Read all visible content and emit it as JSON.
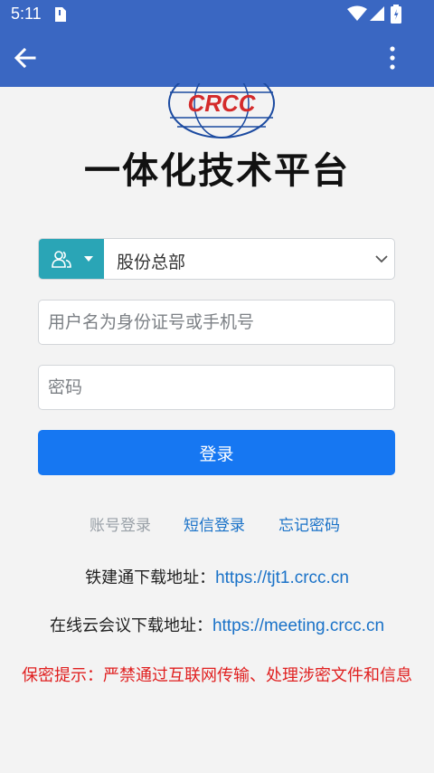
{
  "status_bar": {
    "time": "5:11",
    "icons": [
      "sim-icon",
      "wifi-icon",
      "signal-icon",
      "battery-icon"
    ]
  },
  "app_bar": {
    "back_icon": "arrow-left-icon",
    "menu_icon": "more-vertical-icon",
    "color": "#3a67c2"
  },
  "logo": {
    "text": "CRCC",
    "color": "#d42a2a"
  },
  "title": "一体化技术平台",
  "org_select": {
    "icon": "users-icon",
    "value": "股份总部",
    "prefix_color": "#2aa5b6"
  },
  "username": {
    "placeholder": "用户名为身份证号或手机号",
    "value": ""
  },
  "password": {
    "placeholder": "密码",
    "value": ""
  },
  "login_button": {
    "label": "登录",
    "color": "#1677f2"
  },
  "links": {
    "account_login": "账号登录",
    "sms_login": "短信登录",
    "forgot_password": "忘记密码"
  },
  "downloads": {
    "tjt_label": "铁建通下载地址：",
    "tjt_url": "https://tjt1.crcc.cn",
    "meeting_label": "在线云会议下载地址：",
    "meeting_url": "https://meeting.crcc.cn"
  },
  "notice": "保密提示：严禁通过互联网传输、处理涉密文件和信息"
}
